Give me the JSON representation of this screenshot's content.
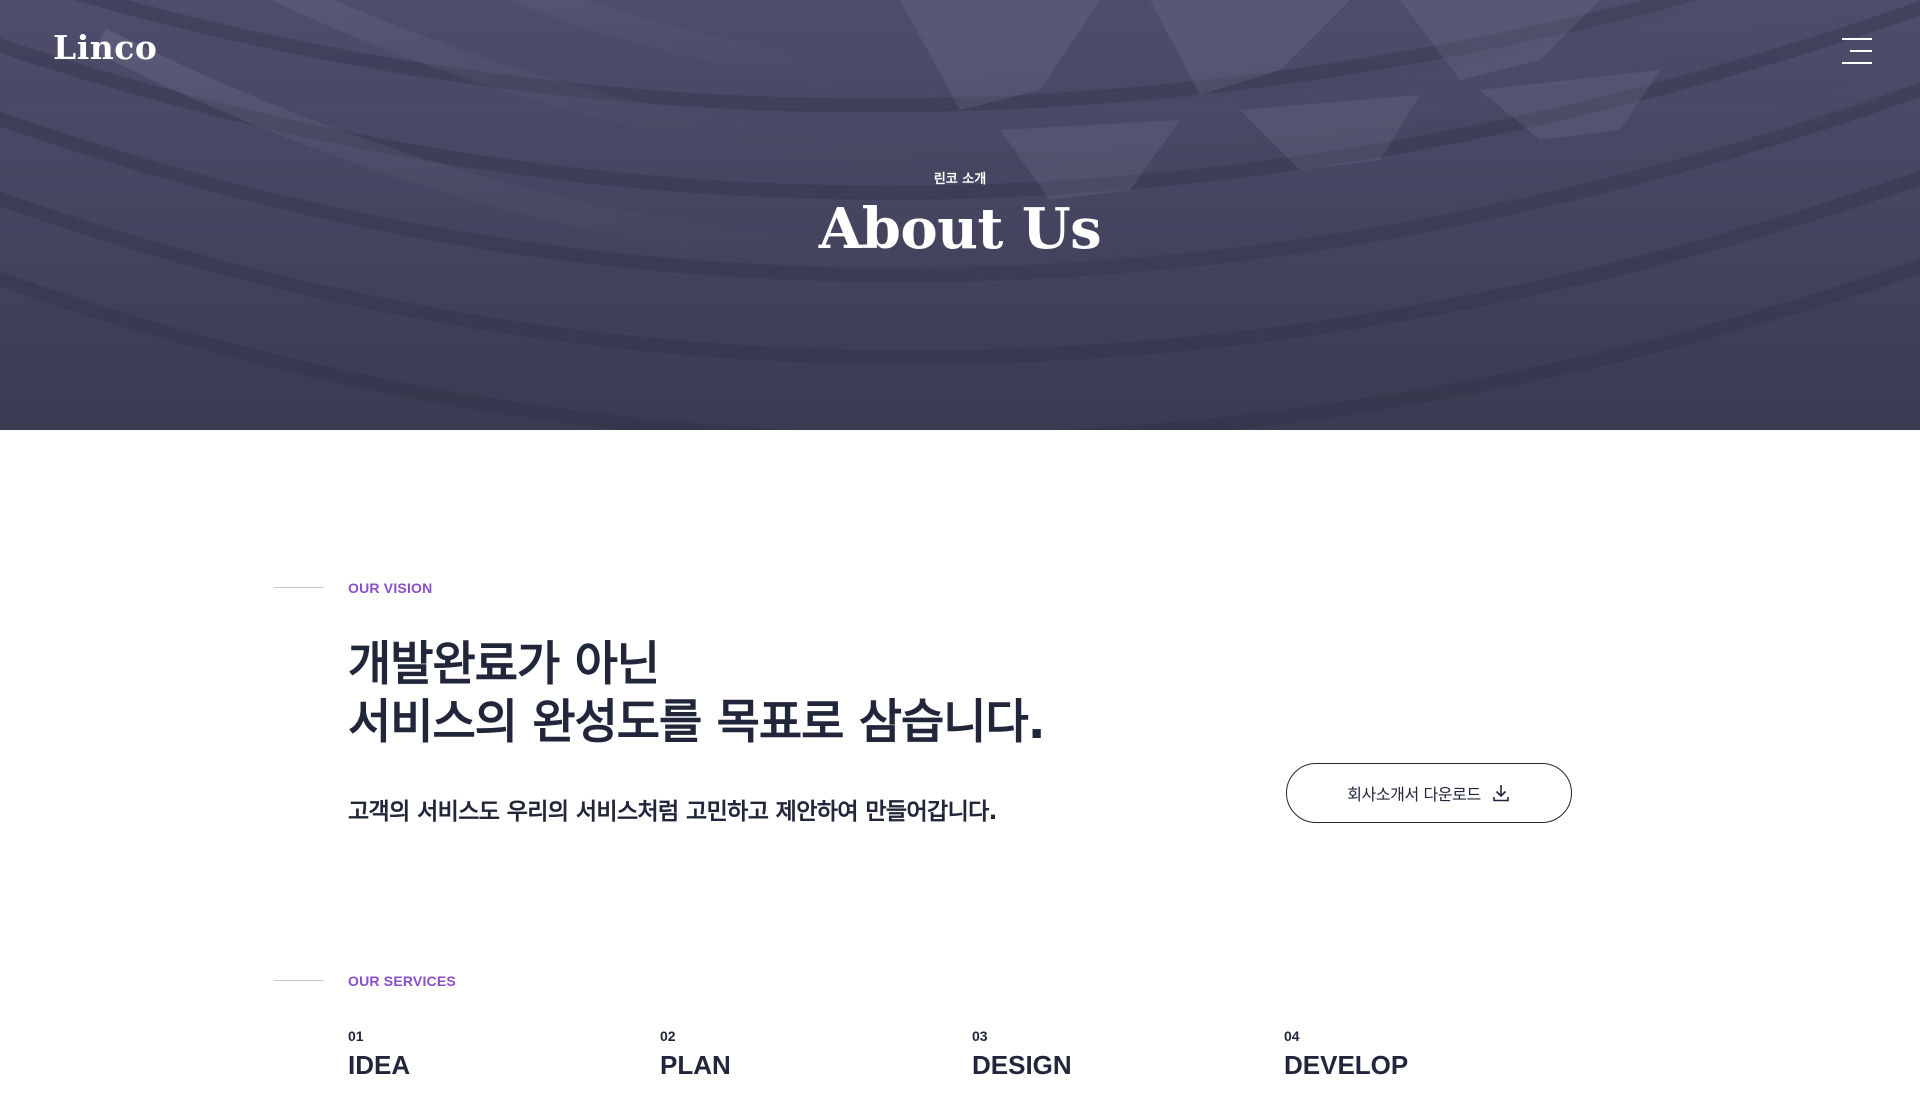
{
  "header": {
    "logo": "Linco",
    "menu_icon": "hamburger-menu-icon"
  },
  "hero": {
    "subtitle": "린코 소개",
    "title": "About Us"
  },
  "vision": {
    "label": "OUR VISION",
    "heading_line1": "개발완료가 아닌",
    "heading_line2": "서비스의 완성도를 목표로 삼습니다.",
    "description": "고객의 서비스도 우리의 서비스처럼 고민하고 제안하여 만들어갑니다.",
    "download_label": "회사소개서 다운로드",
    "download_icon": "download-icon"
  },
  "services": {
    "label": "OUR SERVICES",
    "items": [
      {
        "num": "01",
        "name": "IDEA"
      },
      {
        "num": "02",
        "name": "PLAN"
      },
      {
        "num": "03",
        "name": "DESIGN"
      },
      {
        "num": "04",
        "name": "DEVELOP"
      }
    ]
  },
  "colors": {
    "hero_bg": "#44445f",
    "accent": "#8a4fc7",
    "text": "#22263a"
  }
}
